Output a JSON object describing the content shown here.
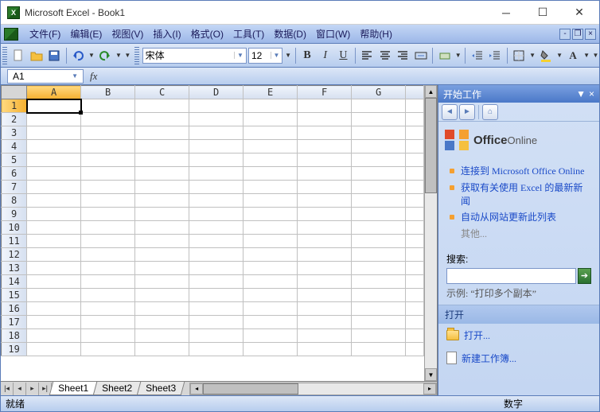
{
  "window": {
    "title": "Microsoft Excel - Book1"
  },
  "menu": {
    "file": "文件(F)",
    "edit": "编辑(E)",
    "view": "视图(V)",
    "insert": "插入(I)",
    "format": "格式(O)",
    "tools": "工具(T)",
    "data": "数据(D)",
    "window": "窗口(W)",
    "help": "帮助(H)"
  },
  "toolbar": {
    "font": "宋体",
    "size": "12"
  },
  "namebox": {
    "ref": "A1",
    "fx": "fx"
  },
  "grid": {
    "cols": [
      "A",
      "B",
      "C",
      "D",
      "E",
      "F",
      "G"
    ],
    "rows": [
      "1",
      "2",
      "3",
      "4",
      "5",
      "6",
      "7",
      "8",
      "9",
      "10",
      "11",
      "12",
      "13",
      "14",
      "15",
      "16",
      "17",
      "18",
      "19"
    ],
    "selected": "A1"
  },
  "sheets": [
    "Sheet1",
    "Sheet2",
    "Sheet3"
  ],
  "taskpane": {
    "title": "开始工作",
    "office": {
      "brand": "Office",
      "online": "Online"
    },
    "links": [
      "连接到 Microsoft Office Online",
      "获取有关使用 Excel 的最新新闻",
      "自动从网站更新此列表"
    ],
    "other": "其他...",
    "search_label": "搜索:",
    "example": "示例: “打印多个副本”",
    "open_header": "打开",
    "open_link": "打开...",
    "new_link": "新建工作簿..."
  },
  "status": {
    "ready": "就绪",
    "num": "数字"
  }
}
